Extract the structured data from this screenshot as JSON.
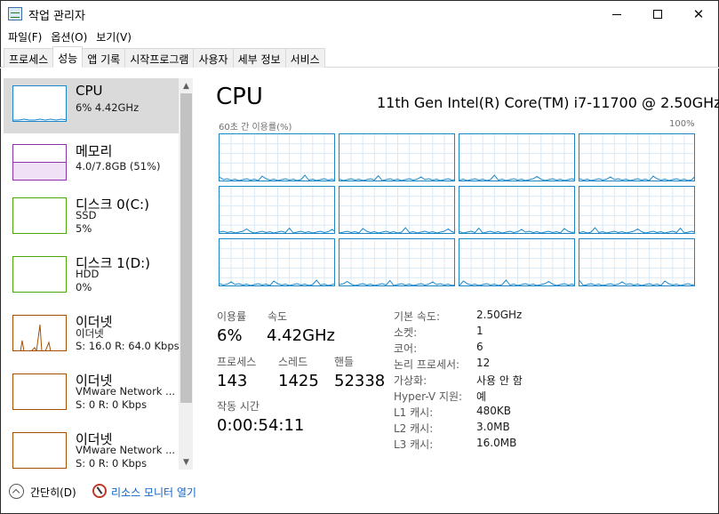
{
  "window": {
    "title": "작업 관리자"
  },
  "menu": [
    "파일(F)",
    "옵션(O)",
    "보기(V)"
  ],
  "tabs": [
    "프로세스",
    "성능",
    "앱 기록",
    "시작프로그램",
    "사용자",
    "세부 정보",
    "서비스"
  ],
  "active_tab": "성능",
  "sidebar": {
    "items": [
      {
        "name": "CPU",
        "lines": [
          "6% 4.42GHz"
        ],
        "color": "#1b87c9"
      },
      {
        "name": "메모리",
        "lines": [
          "4.0/7.8GB (51%)"
        ],
        "color": "#8b34a8",
        "level": 0.51
      },
      {
        "name": "디스크 0(C:)",
        "lines": [
          "SSD",
          "5%"
        ],
        "color": "#4da60c"
      },
      {
        "name": "디스크 1(D:)",
        "lines": [
          "HDD",
          "0%"
        ],
        "color": "#4da60c"
      },
      {
        "name": "이더넷",
        "lines": [
          "이더넷",
          "S: 16.0  R: 64.0 Kbps"
        ],
        "color": "#a74f01"
      },
      {
        "name": "이더넷",
        "lines": [
          "VMware Network ...",
          "S: 0  R: 0 Kbps"
        ],
        "color": "#a74f01"
      },
      {
        "name": "이더넷",
        "lines": [
          "VMware Network ...",
          "S: 0  R: 0 Kbps"
        ],
        "color": "#a74f01"
      }
    ]
  },
  "cpu": {
    "title": "CPU",
    "model": "11th Gen Intel(R) Core(TM) i7-11700 @ 2.50GHz",
    "graph_label": "60초 간 이용률(%)",
    "graph_max": "100%",
    "stats": {
      "utilization_label": "이용률",
      "utilization": "6%",
      "speed_label": "속도",
      "speed": "4.42GHz",
      "processes_label": "프로세스",
      "processes": "143",
      "threads_label": "스레드",
      "threads": "1425",
      "handles_label": "핸들",
      "handles": "52338",
      "uptime_label": "작동 시간",
      "uptime": "0:00:54:11"
    },
    "details": [
      {
        "label": "기본 속도:",
        "value": "2.50GHz"
      },
      {
        "label": "소켓:",
        "value": "1"
      },
      {
        "label": "코어:",
        "value": "6"
      },
      {
        "label": "논리 프로세서:",
        "value": "12"
      },
      {
        "label": "가상화:",
        "value": "사용 안 함"
      },
      {
        "label": "Hyper-V 지원:",
        "value": "예"
      },
      {
        "label": "L1 캐시:",
        "value": "480KB"
      },
      {
        "label": "L2 캐시:",
        "value": "3.0MB"
      },
      {
        "label": "L3 캐시:",
        "value": "16.0MB"
      }
    ]
  },
  "footer": {
    "collapse_label": "간단히(D)",
    "resource_monitor_label": "리소스 모니터 열기"
  },
  "colors": {
    "cpu": "#1b87c9",
    "memory": "#8b34a8",
    "disk": "#4da60c",
    "ethernet": "#a74f01",
    "link": "#0b62c7"
  }
}
